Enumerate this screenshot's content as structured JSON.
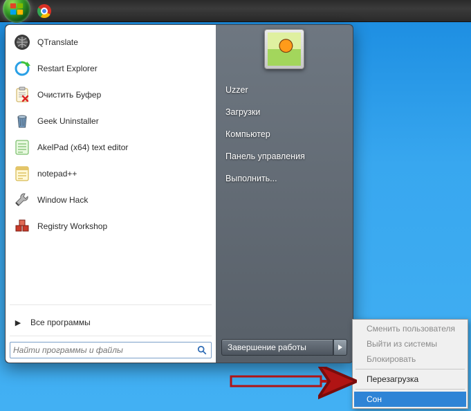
{
  "taskbar": {
    "pinned": [
      {
        "name": "chrome",
        "icon": "chrome-icon"
      }
    ]
  },
  "startmenu": {
    "apps": [
      {
        "name": "qtranslate",
        "icon": "globe",
        "label": "QTranslate"
      },
      {
        "name": "restart-explorer",
        "icon": "refresh",
        "label": "Restart Explorer"
      },
      {
        "name": "clear-buffer",
        "icon": "clipboard-x",
        "label": "Очистить Буфер"
      },
      {
        "name": "geek-uninstaller",
        "icon": "trash",
        "label": "Geek Uninstaller"
      },
      {
        "name": "akelpad",
        "icon": "note-green",
        "label": "AkelPad (x64) text editor"
      },
      {
        "name": "notepadpp",
        "icon": "note-yellow",
        "label": "notepad++"
      },
      {
        "name": "window-hack",
        "icon": "wrench",
        "label": "Window Hack"
      },
      {
        "name": "registry-workshop",
        "icon": "cubes",
        "label": "Registry Workshop"
      }
    ],
    "all_programs_label": "Все программы",
    "search_placeholder": "Найти программы и файлы",
    "right_links": [
      {
        "name": "user",
        "label": "Uzzer"
      },
      {
        "name": "downloads",
        "label": "Загрузки"
      },
      {
        "name": "computer",
        "label": "Компьютер"
      },
      {
        "name": "control-panel",
        "label": "Панель управления"
      },
      {
        "name": "run",
        "label": "Выполнить..."
      }
    ],
    "shutdown_label": "Завершение работы"
  },
  "shutdown_menu": {
    "items": [
      {
        "name": "switch-user",
        "label": "Сменить пользователя",
        "disabled": true
      },
      {
        "name": "log-off",
        "label": "Выйти из системы",
        "disabled": true
      },
      {
        "name": "lock",
        "label": "Блокировать",
        "disabled": true
      }
    ],
    "sep_items": [
      {
        "name": "restart",
        "label": "Перезагрузка",
        "highlight": false
      }
    ],
    "sep2_items": [
      {
        "name": "sleep",
        "label": "Сон",
        "highlight": true
      }
    ]
  }
}
